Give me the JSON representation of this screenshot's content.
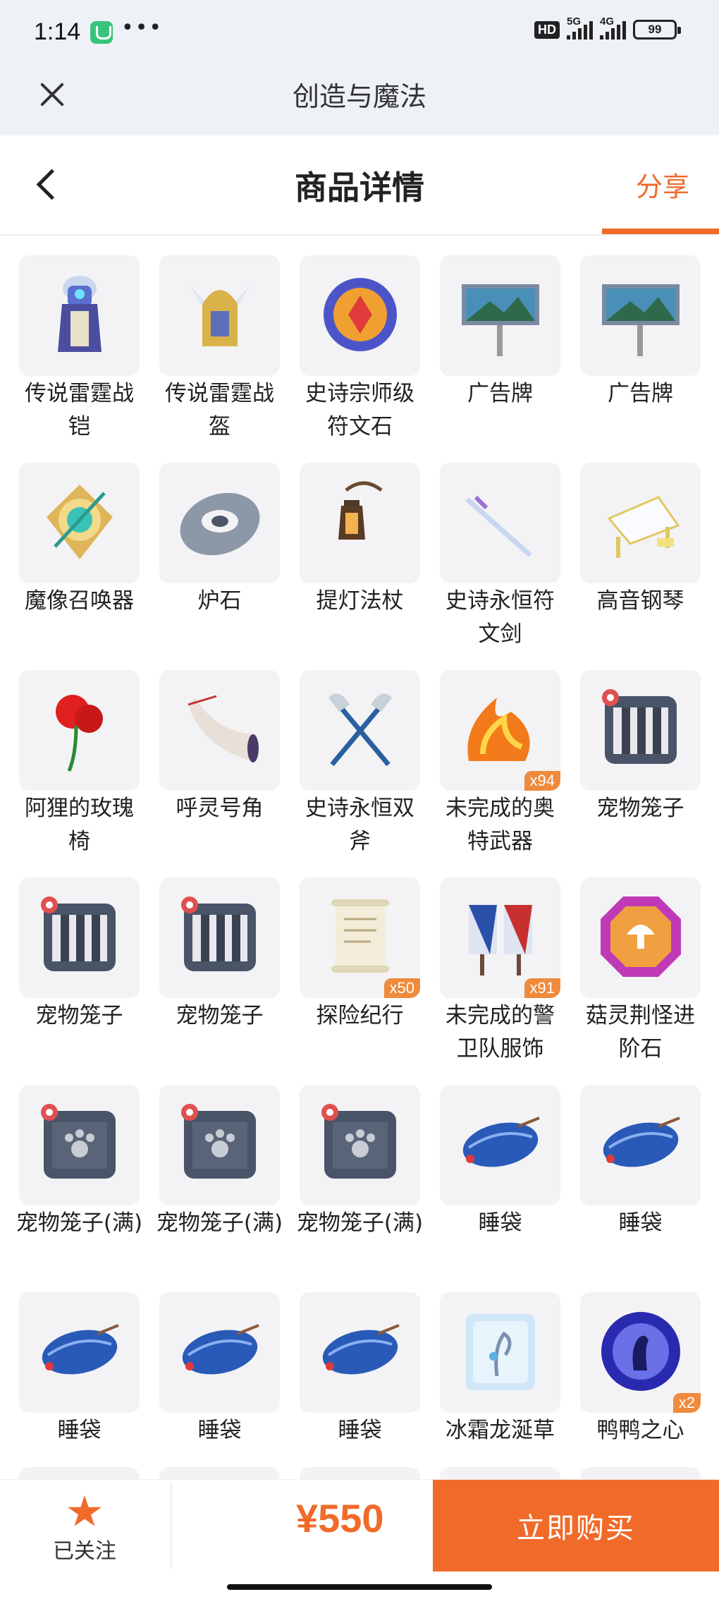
{
  "status": {
    "time": "1:14",
    "dots": "•••",
    "hd": "HD",
    "net1": "5G",
    "net2": "4G",
    "battery": "99"
  },
  "app_bar": {
    "title": "创造与魔法"
  },
  "header": {
    "title": "商品详情",
    "share_label": "分享"
  },
  "items": [
    {
      "name": "传说雷霆战铠",
      "qty": "",
      "icon": "armor-icon"
    },
    {
      "name": "传说雷霆战盔",
      "qty": "",
      "icon": "helmet-icon"
    },
    {
      "name": "史诗宗师级符文石",
      "qty": "",
      "icon": "rune-stone-icon"
    },
    {
      "name": "广告牌",
      "qty": "",
      "icon": "billboard-icon"
    },
    {
      "name": "广告牌",
      "qty": "",
      "icon": "billboard-icon"
    },
    {
      "name": "魔像召唤器",
      "qty": "",
      "icon": "golem-summoner-icon"
    },
    {
      "name": "炉石",
      "qty": "",
      "icon": "hearthstone-icon"
    },
    {
      "name": "提灯法杖",
      "qty": "",
      "icon": "lantern-staff-icon"
    },
    {
      "name": "史诗永恒符文剑",
      "qty": "",
      "icon": "sword-icon"
    },
    {
      "name": "高音钢琴",
      "qty": "",
      "icon": "piano-icon"
    },
    {
      "name": "阿狸的玫瑰椅",
      "qty": "",
      "icon": "rose-chair-icon"
    },
    {
      "name": "呼灵号角",
      "qty": "",
      "icon": "horn-icon"
    },
    {
      "name": "史诗永恒双斧",
      "qty": "",
      "icon": "double-axe-icon"
    },
    {
      "name": "未完成的奥特武器",
      "qty": "x94",
      "icon": "flame-weapon-icon"
    },
    {
      "name": "宠物笼子",
      "qty": "",
      "icon": "pet-cage-icon"
    },
    {
      "name": "宠物笼子",
      "qty": "",
      "icon": "pet-cage-icon"
    },
    {
      "name": "宠物笼子",
      "qty": "",
      "icon": "pet-cage-icon"
    },
    {
      "name": "探险纪行",
      "qty": "x50",
      "icon": "scroll-icon"
    },
    {
      "name": "未完成的警卫队服饰",
      "qty": "x91",
      "icon": "uniform-icon"
    },
    {
      "name": "菇灵荆怪进阶石",
      "qty": "",
      "icon": "mushroom-gem-icon"
    },
    {
      "name": "宠物笼子(满)",
      "qty": "",
      "icon": "pet-cage-full-icon"
    },
    {
      "name": "宠物笼子(满)",
      "qty": "",
      "icon": "pet-cage-full-icon"
    },
    {
      "name": "宠物笼子(满)",
      "qty": "",
      "icon": "pet-cage-full-icon"
    },
    {
      "name": "睡袋",
      "qty": "",
      "icon": "sleeping-bag-icon"
    },
    {
      "name": "睡袋",
      "qty": "",
      "icon": "sleeping-bag-icon"
    },
    {
      "name": "睡袋",
      "qty": "",
      "icon": "sleeping-bag-icon"
    },
    {
      "name": "睡袋",
      "qty": "",
      "icon": "sleeping-bag-icon"
    },
    {
      "name": "睡袋",
      "qty": "",
      "icon": "sleeping-bag-icon"
    },
    {
      "name": "冰霜龙涎草",
      "qty": "",
      "icon": "frost-herb-icon"
    },
    {
      "name": "鸭鸭之心",
      "qty": "x2",
      "icon": "duck-heart-icon"
    }
  ],
  "bottom": {
    "follow_label": "已关注",
    "price": "¥550",
    "buy_label": "立即购买"
  },
  "colors": {
    "accent": "#f06a2a",
    "tile_bg": "#f3f3f5",
    "qty_badge": "#f08a3c"
  }
}
